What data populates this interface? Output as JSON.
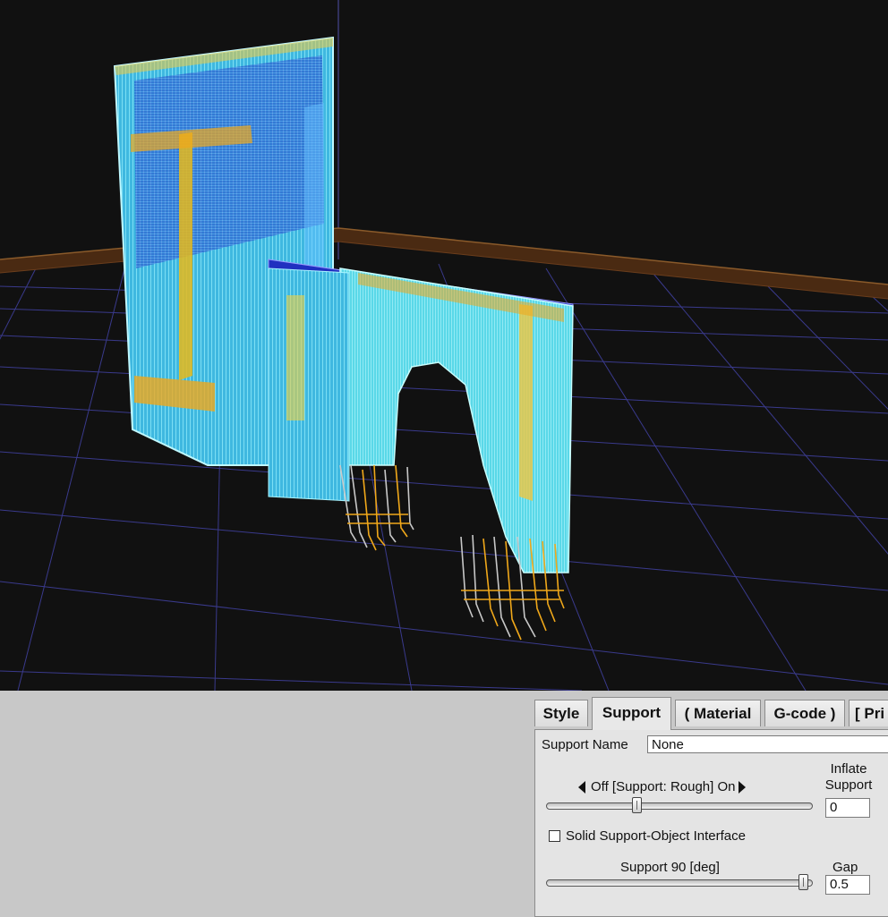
{
  "tabs": [
    {
      "label": "Style",
      "active": false
    },
    {
      "label": "Support",
      "active": true
    },
    {
      "label": "( Material",
      "active": false
    },
    {
      "label": "G-code )",
      "active": false
    },
    {
      "label": "[ Pri",
      "active": false
    }
  ],
  "support": {
    "name_label": "Support Name",
    "name_value": "None",
    "mode_slider_label": "Off [Support: Rough] On",
    "mode_slider_level": 0.34,
    "inflate_label_line1": "Inflate",
    "inflate_label_line2": "Support",
    "inflate_value": "0",
    "solid_interface_label": "Solid Support-Object Interface",
    "solid_interface_checked": false,
    "angle_slider_label": "Support 90 [deg]",
    "angle_slider_level": 1.0,
    "gap_label": "Gap",
    "gap_value": "0.5"
  },
  "colors": {
    "viewport_bg": "#111111",
    "grid_line": "#3a3a8c",
    "build_plate_edge": "#6a3d1c",
    "model_cyan": "#66e0f0",
    "model_blue": "#2f4ad8",
    "support_orange": "#f0a81a",
    "support_gray": "#c8c8c8",
    "panel_bg": "#c8c8c8"
  }
}
